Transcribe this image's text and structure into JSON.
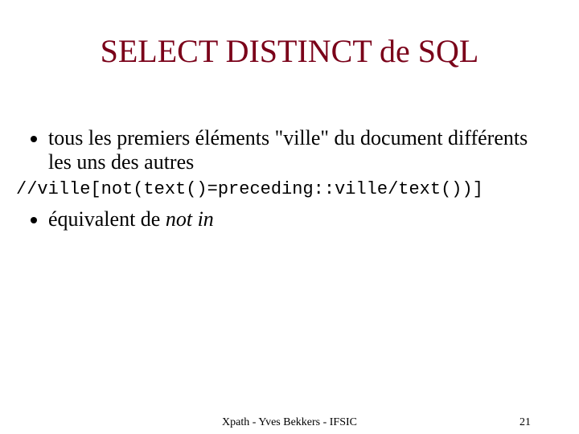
{
  "title": "SELECT DISTINCT de SQL",
  "bullet1": "tous les premiers éléments \"ville\" du document différents les uns des autres",
  "code_line": "//ville[not(text()=preceding::ville/text())]",
  "bullet2_prefix": "équivalent de ",
  "bullet2_italic": "not in",
  "footer_center": "Xpath - Yves Bekkers - IFSIC",
  "page_number": "21"
}
